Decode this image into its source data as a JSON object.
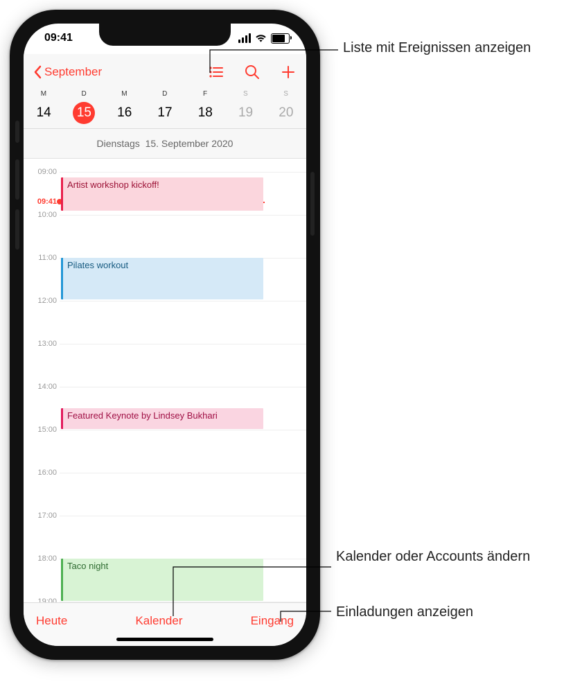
{
  "status": {
    "time": "09:41"
  },
  "nav": {
    "back_label": "September"
  },
  "week": {
    "headers": [
      "M",
      "D",
      "M",
      "D",
      "F",
      "S",
      "S"
    ],
    "numbers": [
      "14",
      "15",
      "16",
      "17",
      "18",
      "19",
      "20"
    ],
    "selected_index": 1
  },
  "full_date": {
    "weekday": "Dienstags",
    "date": "15. September 2020"
  },
  "timeline": {
    "hours": [
      "09:00",
      "10:00",
      "11:00",
      "12:00",
      "13:00",
      "14:00",
      "15:00",
      "16:00",
      "17:00",
      "18:00",
      "19:00"
    ],
    "now_label": "09:41"
  },
  "events": [
    {
      "title": "Artist workshop kickoff!"
    },
    {
      "title": "Pilates workout"
    },
    {
      "title": "Featured Keynote by Lindsey Bukhari"
    },
    {
      "title": "Taco night"
    }
  ],
  "toolbar": {
    "today": "Heute",
    "calendars": "Kalender",
    "inbox": "Eingang"
  },
  "callouts": {
    "list": "Liste mit Ereignissen anzeigen",
    "calendars": "Kalender oder Accounts ändern",
    "invites": "Einladungen anzeigen"
  }
}
